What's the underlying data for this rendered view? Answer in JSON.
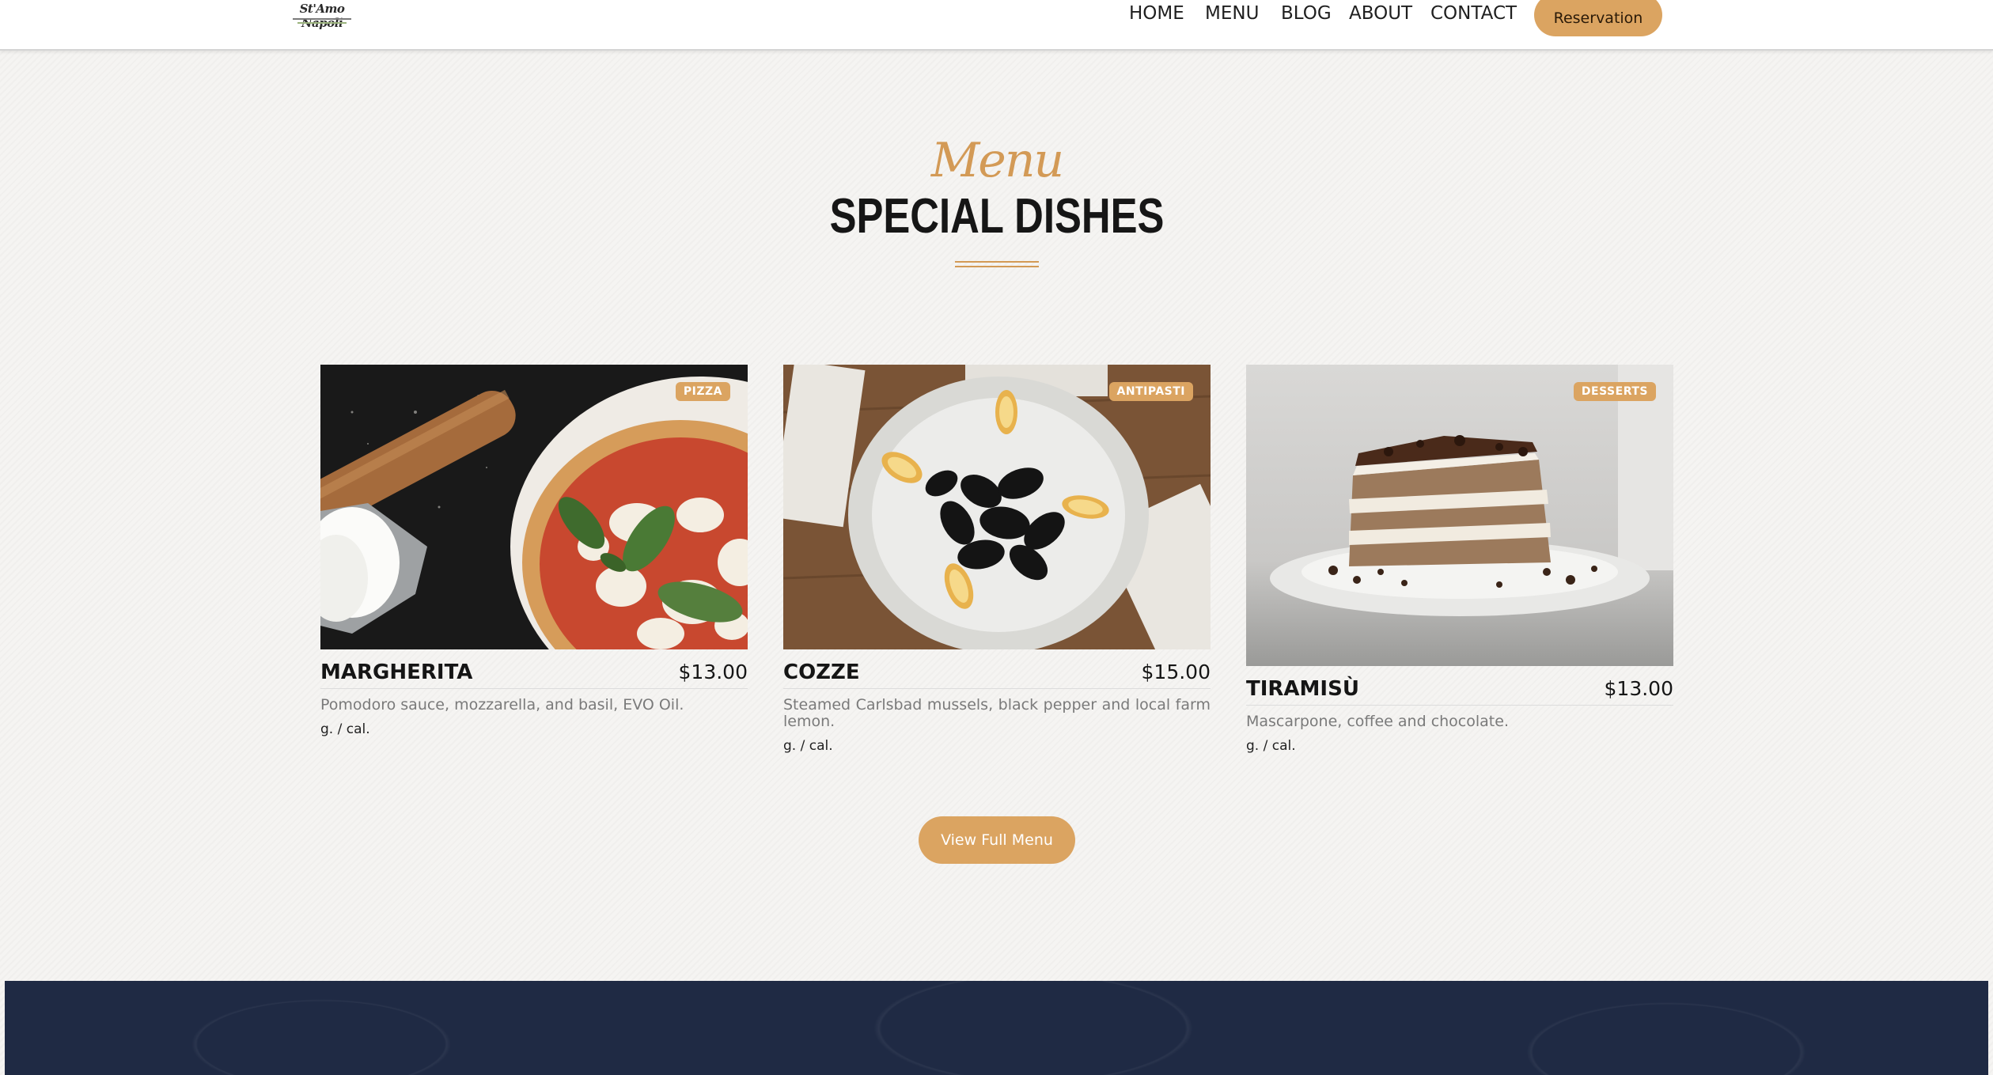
{
  "header": {
    "logo_text": "St'Amo Napoli",
    "nav": [
      "HOME",
      "MENU",
      "BLOG",
      "ABOUT",
      "CONTACT"
    ],
    "reservation_label": "Reservation"
  },
  "section": {
    "subtitle": "Menu",
    "title": "SPECIAL DISHES"
  },
  "dishes": [
    {
      "badge": "PIZZA",
      "name": "MARGHERITA",
      "price": "$13.00",
      "description": "Pomodoro sauce, mozzarella, and basil, EVO Oil.",
      "meta": "g. / cal."
    },
    {
      "badge": "ANTIPASTI",
      "name": "COZZE",
      "price": "$15.00",
      "description": "Steamed Carlsbad mussels, black pepper and local farm lemon.",
      "meta": "g. / cal."
    },
    {
      "badge": "DESSERTS",
      "name": "TIRAMISÙ",
      "price": "$13.00",
      "description": "Mascarpone, coffee and chocolate.",
      "meta": "g. / cal."
    }
  ],
  "view_menu_label": "View Full Menu",
  "colors": {
    "accent": "#dba461",
    "title": "#161616",
    "footer": "#1f2a44"
  }
}
